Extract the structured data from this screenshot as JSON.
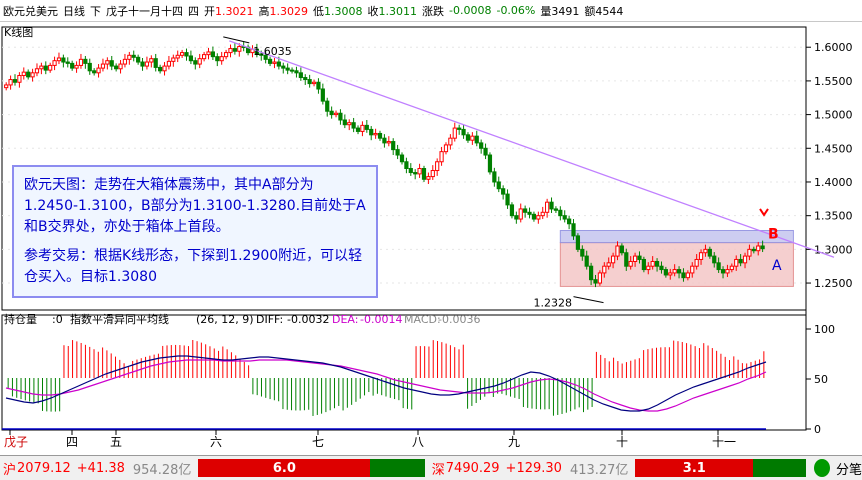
{
  "header": {
    "instrument": "欧元兑美元",
    "period": "日线",
    "direction": "下",
    "date_label": "戊子十一月十四",
    "weekday": "四",
    "open_label": "开",
    "open": "1.3021",
    "high_label": "高",
    "high": "1.3029",
    "low_label": "低",
    "low": "1.3008",
    "close_label": "收",
    "close": "1.3011",
    "change_label": "涨跌",
    "change": "-0.0008",
    "change_pct": "-0.06%",
    "volume_label": "量",
    "volume": "3491",
    "amount_label": "额",
    "amount": "4544"
  },
  "panel": {
    "kline_tab": "K线图"
  },
  "chart_data": [
    {
      "type": "candlestick",
      "ylim": [
        1.21,
        1.63
      ],
      "yticks": [
        "1.6000",
        "1.5500",
        "1.5000",
        "1.4500",
        "1.4000",
        "1.3500",
        "1.3000",
        "1.2500"
      ],
      "ytick_values": [
        1.6,
        1.55,
        1.5,
        1.45,
        1.4,
        1.35,
        1.3,
        1.25
      ],
      "annotations": {
        "high_label": "1.6035",
        "low_label": "1.2328",
        "box_a_label": "A",
        "box_b_label": "B",
        "box_a_range": [
          1.245,
          1.31
        ],
        "box_b_range": [
          1.31,
          1.328
        ],
        "trendline": [
          1.6035,
          1.315
        ]
      },
      "closes": [
        1.544,
        1.552,
        1.548,
        1.558,
        1.563,
        1.556,
        1.562,
        1.568,
        1.572,
        1.566,
        1.573,
        1.58,
        1.584,
        1.578,
        1.576,
        1.569,
        1.573,
        1.582,
        1.576,
        1.565,
        1.562,
        1.569,
        1.575,
        1.58,
        1.572,
        1.568,
        1.575,
        1.582,
        1.588,
        1.585,
        1.578,
        1.572,
        1.578,
        1.583,
        1.57,
        1.565,
        1.572,
        1.579,
        1.584,
        1.588,
        1.592,
        1.587,
        1.58,
        1.575,
        1.583,
        1.589,
        1.593,
        1.586,
        1.58,
        1.586,
        1.592,
        1.598,
        1.594,
        1.601,
        1.6,
        1.592,
        1.597,
        1.59,
        1.588,
        1.582,
        1.576,
        1.578,
        1.572,
        1.569,
        1.566,
        1.565,
        1.562,
        1.555,
        1.552,
        1.546,
        1.548,
        1.538,
        1.52,
        1.505,
        1.5,
        1.502,
        1.492,
        1.485,
        1.488,
        1.48,
        1.475,
        1.484,
        1.478,
        1.47,
        1.472,
        1.465,
        1.458,
        1.46,
        1.448,
        1.44,
        1.43,
        1.42,
        1.414,
        1.412,
        1.42,
        1.404,
        1.408,
        1.417,
        1.43,
        1.445,
        1.455,
        1.465,
        1.48,
        1.478,
        1.47,
        1.462,
        1.468,
        1.458,
        1.45,
        1.44,
        1.415,
        1.4,
        1.39,
        1.382,
        1.366,
        1.35,
        1.345,
        1.36,
        1.355,
        1.352,
        1.345,
        1.35,
        1.355,
        1.37,
        1.36,
        1.358,
        1.35,
        1.345,
        1.338,
        1.32,
        1.3,
        1.29,
        1.275,
        1.255,
        1.25,
        1.265,
        1.275,
        1.28,
        1.29,
        1.305,
        1.295,
        1.275,
        1.282,
        1.29,
        1.285,
        1.27,
        1.275,
        1.282,
        1.275,
        1.27,
        1.262,
        1.265,
        1.27,
        1.265,
        1.258,
        1.265,
        1.275,
        1.285,
        1.295,
        1.3,
        1.29,
        1.28,
        1.27,
        1.265,
        1.27,
        1.275,
        1.285,
        1.28,
        1.29,
        1.3,
        1.298,
        1.305,
        1.301
      ]
    },
    {
      "type": "bar",
      "indicator_title": "持仓量",
      "indicator_value": ":0",
      "macd_title": "指数平滑异同平均线",
      "macd_params": "(26, 12, 9)",
      "diff_label": "DIFF:",
      "diff": "-0.0032",
      "dea_label": "DEA:",
      "dea": "-0.0014",
      "macd_label": "MACD:",
      "macd": "-0.0036",
      "yticks": [
        "100",
        "50",
        "0"
      ],
      "ytick_values": [
        100,
        50,
        0
      ],
      "ylim": [
        0,
        100
      ],
      "histogram_sign": [
        -1,
        -1,
        -1,
        -1,
        -1,
        -1,
        -1,
        -1,
        -1,
        -1,
        -1,
        -1,
        -1,
        1,
        1,
        1,
        1,
        1,
        1,
        1,
        1,
        1,
        1,
        1,
        1,
        1,
        1,
        1,
        1,
        1,
        1,
        1,
        1,
        1,
        1,
        1,
        1,
        1,
        1,
        1,
        1,
        1,
        1,
        1,
        1,
        1,
        1,
        1,
        1,
        1,
        1,
        1,
        1,
        1,
        1,
        1,
        1,
        -1,
        -1,
        -1,
        -1,
        -1,
        -1,
        -1,
        -1,
        -1,
        -1,
        -1,
        -1,
        -1,
        -1,
        -1,
        -1,
        -1,
        -1,
        -1,
        -1,
        -1,
        -1,
        -1,
        -1,
        -1,
        -1,
        -1,
        -1,
        -1,
        -1,
        -1,
        -1,
        -1,
        -1,
        -1,
        -1,
        -1,
        -1,
        1,
        1,
        1,
        1,
        1,
        1,
        1,
        1,
        1,
        1,
        1,
        1,
        -1,
        -1,
        -1,
        -1,
        -1,
        -1,
        -1,
        -1,
        -1,
        -1,
        -1,
        -1,
        -1,
        -1,
        -1,
        -1,
        -1,
        -1,
        -1,
        -1,
        -1,
        -1,
        -1,
        -1,
        -1,
        -1,
        -1,
        -1,
        -1,
        -1,
        1,
        1,
        1,
        1,
        1,
        1,
        1,
        1,
        1,
        1,
        1,
        1,
        1,
        1,
        1,
        1,
        1,
        1,
        1,
        1,
        1,
        1,
        1,
        1,
        1,
        1,
        1,
        1,
        1,
        1,
        1,
        1,
        1,
        1,
        1,
        1,
        1,
        1,
        1,
        1
      ],
      "series_diff": [
        30,
        28,
        26,
        25,
        27,
        30,
        34,
        38,
        42,
        46,
        50,
        54,
        57,
        60,
        63,
        66,
        68,
        70,
        71,
        72,
        72,
        71,
        70,
        69,
        68,
        68,
        69,
        70,
        71,
        71,
        70,
        69,
        68,
        67,
        66,
        65,
        63,
        61,
        58,
        55,
        52,
        49,
        46,
        43,
        40,
        38,
        36,
        34,
        33,
        33,
        34,
        36,
        38,
        40,
        42,
        45,
        49,
        53,
        56,
        55,
        52,
        48,
        43,
        38,
        33,
        28,
        24,
        21,
        18,
        17,
        17,
        19,
        23,
        28,
        33,
        37,
        41,
        44,
        47,
        50,
        53,
        56,
        60,
        63,
        66
      ],
      "series_dea": [
        40,
        38,
        36,
        34,
        33,
        33,
        34,
        36,
        38,
        41,
        44,
        47,
        50,
        53,
        56,
        59,
        62,
        64,
        66,
        67,
        68,
        68,
        68,
        68,
        67,
        67,
        67,
        67,
        68,
        68,
        68,
        68,
        67,
        66,
        65,
        64,
        63,
        62,
        60,
        58,
        56,
        54,
        51,
        48,
        46,
        44,
        42,
        40,
        38,
        37,
        36,
        35,
        35,
        35,
        36,
        38,
        40,
        43,
        46,
        48,
        49,
        48,
        46,
        43,
        39,
        34,
        30,
        26,
        23,
        20,
        18,
        17,
        17,
        19,
        22,
        26,
        30,
        33,
        36,
        39,
        42,
        45,
        49,
        52,
        56
      ]
    }
  ],
  "x_axis": {
    "month_labels": [
      "戊子",
      "四",
      "五",
      "六",
      "七",
      "八",
      "九",
      "十",
      "十一"
    ]
  },
  "status_bar": {
    "sh_label": "沪",
    "sh_index": "2079.12",
    "sh_change": "+41.38",
    "sh_amount": "954.28亿",
    "sh_bar_value": "6.0",
    "sz_label": "深",
    "sz_index": "7490.29",
    "sz_change": "+129.30",
    "sz_amount": "413.27亿",
    "sz_bar_value": "3.1",
    "pen_label": "分笔"
  },
  "note": {
    "p1": "欧元天图：走势在大箱体震荡中，其中A部分为1.2450-1.3100，B部分为1.3100-1.3280.目前处于A和B交界处，亦处于箱体上首段。",
    "p2": "参考交易：根据K线形态，下探到1.2900附近，可以轻仓买入。目标1.3080"
  },
  "colors": {
    "up": "#ff0000",
    "down": "#008000",
    "trendline": "#c080ff",
    "box_a": "#f4c7c7",
    "box_b": "#c8c8f0",
    "diff_line": "#000080",
    "dea_line": "#cc00cc",
    "axis": "#000000",
    "grid": "#d8d8d8"
  }
}
